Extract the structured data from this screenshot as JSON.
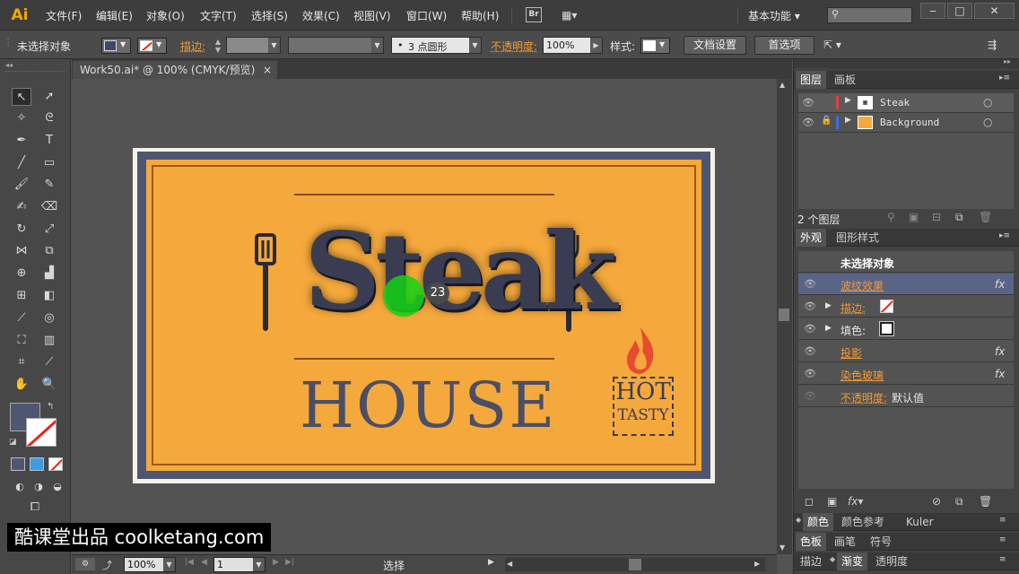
{
  "app": {
    "logo": "Ai"
  },
  "menu": {
    "items": [
      "文件(F)",
      "编辑(E)",
      "对象(O)",
      "文字(T)",
      "选择(S)",
      "效果(C)",
      "视图(V)",
      "窗口(W)",
      "帮助(H)"
    ],
    "bridge": "Br",
    "workspace": "基本功能",
    "search_placeholder": ""
  },
  "control": {
    "selection": "未选择对象",
    "stroke_label": "描边:",
    "brush": "3 点圆形",
    "opacity_label": "不透明度:",
    "opacity_value": "100%",
    "style_label": "样式:",
    "doc_setup": "文档设置",
    "preferences": "首选项"
  },
  "document": {
    "tab_title": "Work50.ai* @ 100% (CMYK/预览)",
    "close": "×"
  },
  "artwork": {
    "title": "Steak",
    "subtitle": "HOUSE",
    "badge_top": "HOT",
    "badge_bottom": "TASTY"
  },
  "cursor": {
    "click_count": "23"
  },
  "status": {
    "zoom": "100%",
    "page": "1",
    "tool": "选择"
  },
  "layers_panel": {
    "tabs": [
      "图层",
      "画板"
    ],
    "layers": [
      {
        "name": "Steak",
        "color": "#e04040"
      },
      {
        "name": "Background",
        "color": "#3d6ce0"
      }
    ],
    "count": "2 个图层"
  },
  "appearance_panel": {
    "tabs": [
      "外观",
      "图形样式"
    ],
    "header": "未选择对象",
    "rows": [
      {
        "label": "波纹效果",
        "fx": "fx",
        "selected": true
      },
      {
        "label": "描边:",
        "swatch": "none",
        "expand": true
      },
      {
        "label": "填色:",
        "swatch": "white",
        "expand": true
      },
      {
        "label": "投影",
        "fx": "fx"
      },
      {
        "label": "染色玻璃",
        "fx": "fx"
      },
      {
        "label": "不透明度:",
        "value": "默认值"
      }
    ]
  },
  "bottom_panels": {
    "row1": [
      "颜色",
      "颜色参考",
      "Kuler"
    ],
    "row2": [
      "色板",
      "画笔",
      "符号"
    ],
    "row3": [
      "描边",
      "渐变",
      "透明度"
    ]
  },
  "watermark": "酷课堂出品 coolketang.com",
  "colors": {
    "accent": "#f7a600",
    "poster_orange": "#f5a93c",
    "poster_blue": "#4f5672",
    "selected_row": "#5a6486"
  }
}
